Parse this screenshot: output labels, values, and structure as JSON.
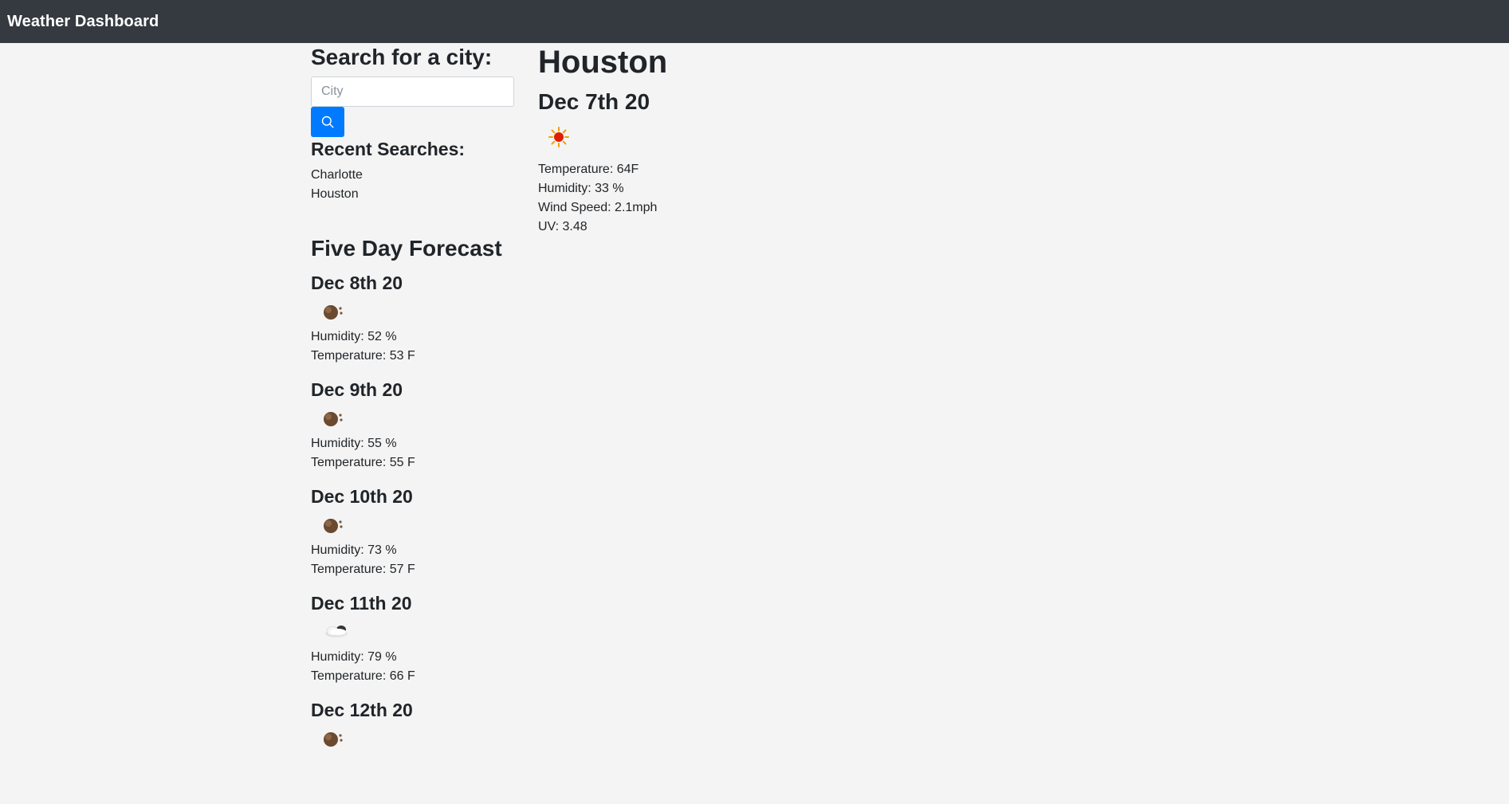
{
  "navbar": {
    "title": "Weather Dashboard"
  },
  "search": {
    "heading": "Search for a city:",
    "placeholder": "City",
    "value": "",
    "button_icon": "search-icon"
  },
  "recent": {
    "heading": "Recent Searches:",
    "items": [
      "Charlotte",
      "Houston"
    ]
  },
  "current": {
    "city": "Houston",
    "date": "Dec 7th 20",
    "icon": "sun-icon",
    "temperature": "Temperature: 64F",
    "humidity": "Humidity: 33 %",
    "wind": "Wind Speed: 2.1mph",
    "uv": "UV: 3.48"
  },
  "forecast": {
    "heading": "Five Day Forecast",
    "days": [
      {
        "date": "Dec 8th 20",
        "icon": "moon-icon",
        "humidity": "Humidity: 52 %",
        "temperature": "Temperature: 53 F"
      },
      {
        "date": "Dec 9th 20",
        "icon": "moon-icon",
        "humidity": "Humidity: 55 %",
        "temperature": "Temperature: 55 F"
      },
      {
        "date": "Dec 10th 20",
        "icon": "moon-icon",
        "humidity": "Humidity: 73 %",
        "temperature": "Temperature: 57 F"
      },
      {
        "date": "Dec 11th 20",
        "icon": "cloud-icon",
        "humidity": "Humidity: 79 %",
        "temperature": "Temperature: 66 F"
      },
      {
        "date": "Dec 12th 20",
        "icon": "moon-icon"
      }
    ]
  }
}
